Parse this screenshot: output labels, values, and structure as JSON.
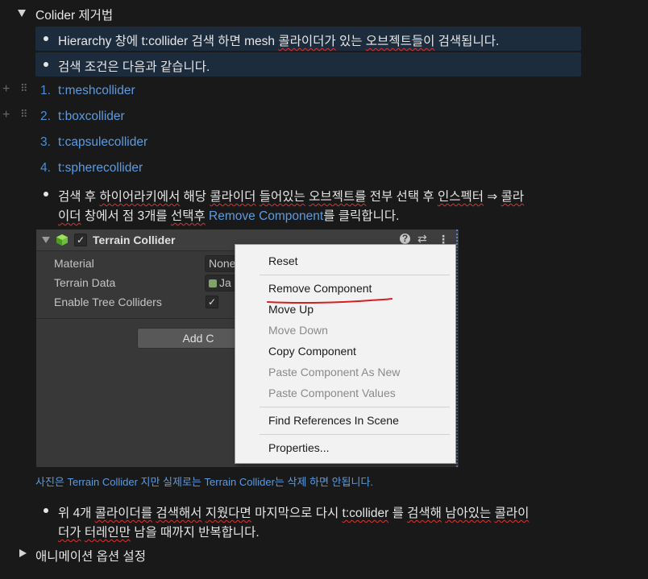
{
  "section1": {
    "title": "Colider 제거법",
    "bullet1": {
      "pre": "Hierarchy 창에 t:collider 검색 하면 mesh ",
      "squig1": "콜라이더가",
      "mid": " 있는 ",
      "squig2": "오브젝트들이",
      "post": " 검색됩니다."
    },
    "bullet2": "검색 조건은 다음과 같습니다.",
    "ordered": [
      {
        "num": "1.",
        "text": "t:meshcollider"
      },
      {
        "num": "2.",
        "text": "t:boxcollider"
      },
      {
        "num": "3.",
        "text": "t:capsulecollider"
      },
      {
        "num": "4.",
        "text": "t:spherecollider"
      }
    ],
    "bullet3": {
      "line1_a": "검색 후 ",
      "line1_sq1": "하이어라키에서",
      "line1_b": " 해당 ",
      "line1_sq2": "콜라이더",
      "line1_c": " ",
      "line1_sq3": "들어있는",
      "line1_d": " ",
      "line1_sq4": "오브젝트를",
      "line1_e": " 전부 선택 후 ",
      "line1_sq5": "인스펙터",
      "line1_f": " ⇒ ",
      "line1_sq6": "콜라",
      "line2_sq1": "이더",
      "line2_a": " 창에서 점 3개를 ",
      "line2_sq2": "선택후",
      "line2_b": " ",
      "line2_link": "Remove Component",
      "line2_c": "를 클릭합니다."
    },
    "screenshot": {
      "component": "Terrain Collider",
      "props": [
        "Material",
        "Terrain Data",
        "Enable Tree Colliders"
      ],
      "material_value": "None",
      "terrain_value": "Ja",
      "add_button": "Add C",
      "menu": {
        "reset": "Reset",
        "remove": "Remove Component",
        "move_up": "Move Up",
        "move_down": "Move Down",
        "copy": "Copy Component",
        "paste_new": "Paste Component As New",
        "paste_values": "Paste Component Values",
        "find_refs": "Find References In Scene",
        "properties": "Properties..."
      }
    },
    "caption": "사진은 Terrain Collider 지만 실제로는 Terrain Collider는 삭제 하면 안됩니다.",
    "bullet4": {
      "line1_a": "위 4개 ",
      "line1_sq1": "콜라이더를",
      "line1_b": " ",
      "line1_sq2": "검색해서",
      "line1_c": " ",
      "line1_sq3": "지웠다면",
      "line1_d": " 마지막으로 다시 ",
      "line1_sq4": "t:collider",
      "line1_e": " 를 ",
      "line1_sq5": "검색해",
      "line1_f": " ",
      "line1_sq6": "남아있는",
      "line1_g": " ",
      "line1_sq7": "콜라이",
      "line2_sq1": "더가",
      "line2_a": " ",
      "line2_sq2": "터레인만",
      "line2_b": " 남을 때까지 반복합니다."
    }
  },
  "section2": {
    "title": "애니메이션 옵션 설정"
  },
  "colors": {
    "background": "#191919",
    "link": "#5d9be0",
    "highlight_row": "#1d2c3c",
    "underline_annotation": "#d42020"
  }
}
